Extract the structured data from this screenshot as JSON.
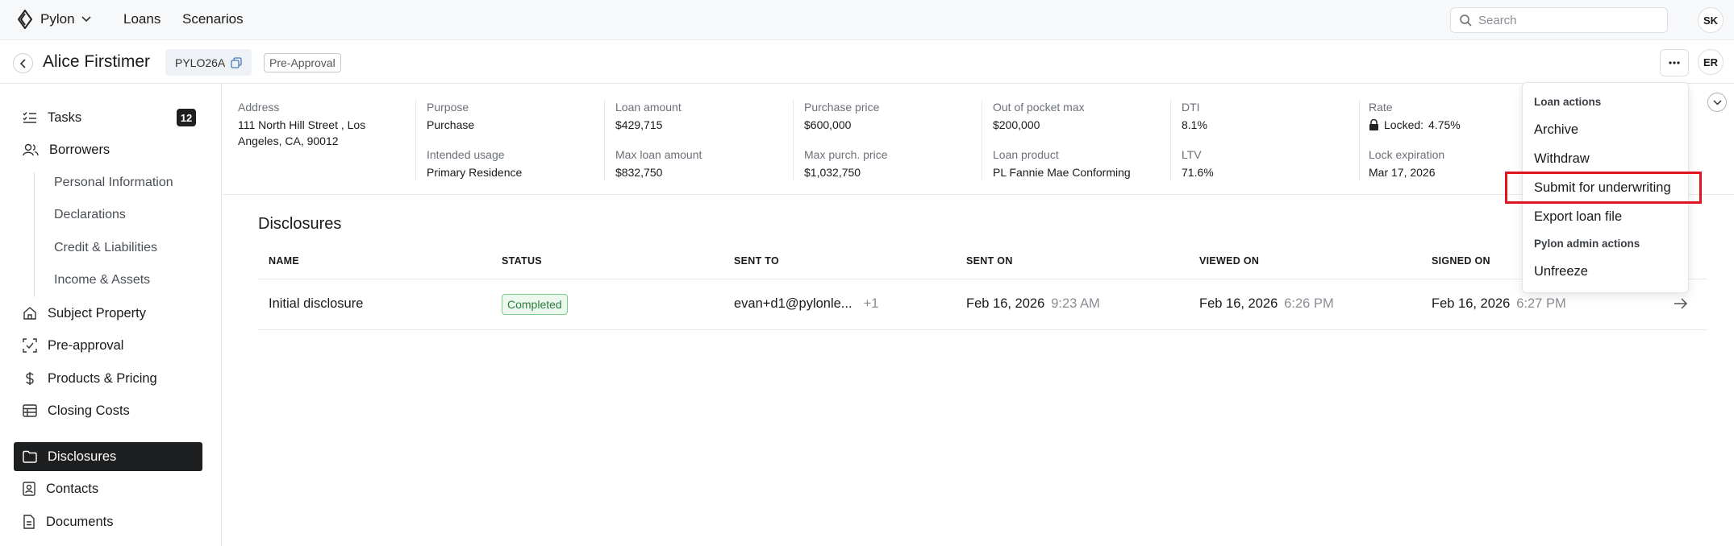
{
  "topbar": {
    "app_name": "Pylon",
    "nav": [
      "Loans",
      "Scenarios"
    ],
    "search_placeholder": "Search",
    "user_initials": "SK"
  },
  "loan_header": {
    "borrower_name": "Alice Firstimer",
    "loan_id": "PYLO26A",
    "stage": "Pre-Approval",
    "assignee_initials": "ER"
  },
  "sidebar": {
    "tasks": {
      "label": "Tasks",
      "count": "12"
    },
    "borrowers": {
      "label": "Borrowers",
      "sub": [
        "Personal Information",
        "Declarations",
        "Credit & Liabilities",
        "Income & Assets"
      ]
    },
    "items": [
      "Subject Property",
      "Pre-approval",
      "Products & Pricing",
      "Closing Costs",
      "Disclosures",
      "Contacts",
      "Documents"
    ],
    "active": "Disclosures"
  },
  "summary": [
    {
      "label": "Address",
      "value": "111 North Hill Street , Los Angeles, CA, 90012"
    },
    {
      "label": "Purpose",
      "value": "Purchase",
      "label2": "Intended usage",
      "value2": "Primary Residence"
    },
    {
      "label": "Loan amount",
      "value": "$429,715",
      "label2": "Max loan amount",
      "value2": "$832,750"
    },
    {
      "label": "Purchase price",
      "value": "$600,000",
      "label2": "Max purch. price",
      "value2": "$1,032,750"
    },
    {
      "label": "Out of pocket max",
      "value": "$200,000",
      "label2": "Loan product",
      "value2": "PL Fannie Mae Conforming"
    },
    {
      "label": "DTI",
      "value": "8.1%",
      "label2": "LTV",
      "value2": "71.6%"
    },
    {
      "label": "Rate",
      "value_prefix": "Locked:",
      "value": "4.75%",
      "label2": "Lock expiration",
      "value2": "Mar 17, 2026"
    }
  ],
  "disclosures": {
    "title": "Disclosures",
    "columns": [
      "NAME",
      "STATUS",
      "SENT TO",
      "SENT ON",
      "VIEWED ON",
      "SIGNED ON"
    ],
    "rows": [
      {
        "name": "Initial disclosure",
        "status": "Completed",
        "sent_to": "evan+d1@pylonle...",
        "sent_to_extra": "+1",
        "sent_on_date": "Feb 16, 2026",
        "sent_on_time": "9:23 AM",
        "viewed_on_date": "Feb 16, 2026",
        "viewed_on_time": "6:26 PM",
        "signed_on_date": "Feb 16, 2026",
        "signed_on_time": "6:27 PM"
      }
    ]
  },
  "actions_menu": {
    "loan_actions_header": "Loan actions",
    "loan_actions": [
      "Archive",
      "Withdraw",
      "Submit for underwriting",
      "Export loan file"
    ],
    "admin_header": "Pylon admin actions",
    "admin_actions": [
      "Unfreeze"
    ],
    "highlighted": "Submit for underwriting",
    "highlight_color": "#e0141e"
  }
}
